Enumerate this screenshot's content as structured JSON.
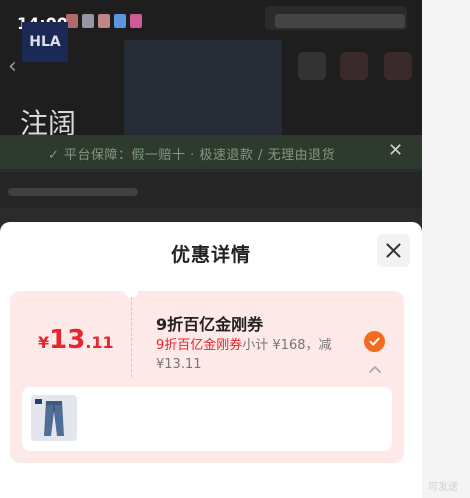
{
  "status_bar": {
    "time": "14:00"
  },
  "background_page": {
    "brand_badge": "HLA",
    "heading_char": "注阔",
    "guarantee_text": "✓ 平台保障：假一赔十 · 极速退款 / 无理由退货"
  },
  "sheet": {
    "title": "优惠详情",
    "coupon": {
      "currency": "¥",
      "amount_int": "13",
      "amount_dec": ".11",
      "name": "9折百亿金刚券",
      "desc_highlight": "9折百亿金刚券",
      "desc_rest": "小计 ¥168，减 ¥13.11",
      "selected": true
    },
    "product": {
      "thumbnail": "jeans-image"
    }
  },
  "gutter_text": "可发送",
  "colors": {
    "accent_red": "#e8242f",
    "check_orange": "#f46c1b",
    "coupon_bg": "#fde9e7"
  }
}
